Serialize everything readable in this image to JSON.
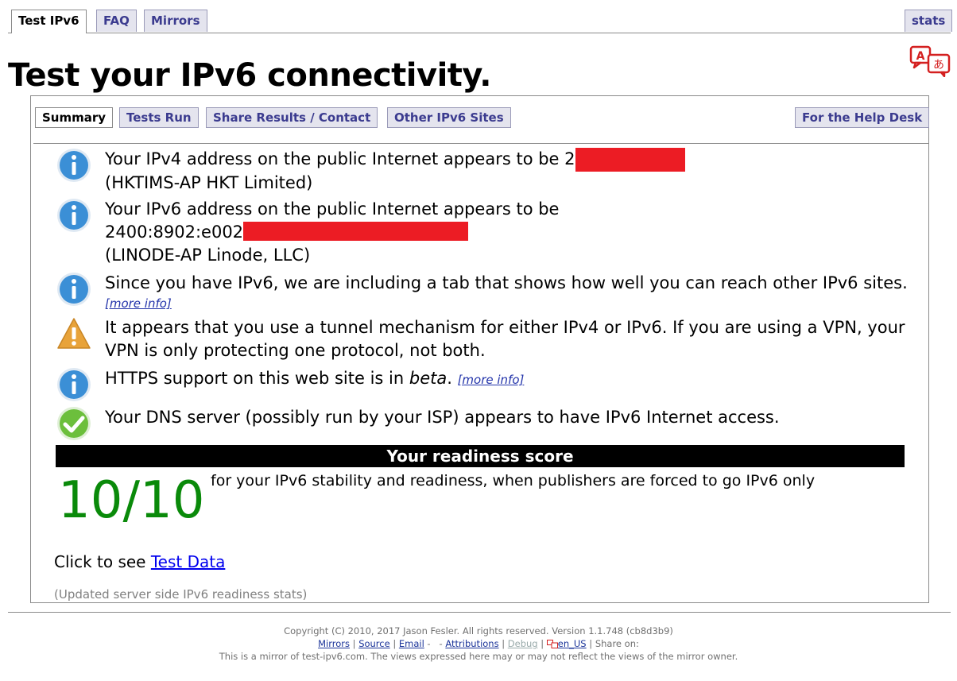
{
  "top_tabs": [
    {
      "label": "Test IPv6",
      "active": true
    },
    {
      "label": "FAQ",
      "active": false
    },
    {
      "label": "Mirrors",
      "active": false
    }
  ],
  "stats_tab": "stats",
  "page_title": "Test your IPv6 connectivity.",
  "sub_tabs": [
    {
      "label": "Summary",
      "active": true
    },
    {
      "label": "Tests Run",
      "active": false
    },
    {
      "label": "Share Results / Contact",
      "active": false
    },
    {
      "label": "Other IPv6 Sites",
      "active": false
    }
  ],
  "help_desk_tab": "For the Help Desk",
  "messages": {
    "ipv4": {
      "icon": "info-icon",
      "line1": "Your IPv4 address on the public Internet appears to be 2",
      "line2": "(HKTIMS-AP HKT Limited)"
    },
    "ipv6": {
      "icon": "info-icon",
      "line1": "Your IPv6 address on the public Internet appears to be",
      "line2": "2400:8902:e002",
      "line3": "(LINODE-AP Linode, LLC)"
    },
    "tab_note": {
      "icon": "info-icon",
      "line1": "Since you have IPv6, we are including a tab that shows how well you can reach other IPv6 sites.",
      "more": "[more info]"
    },
    "tunnel": {
      "icon": "warning-icon",
      "line1": "It appears that you use a tunnel mechanism for either IPv4 or IPv6. If you are using a VPN, your",
      "line2": "VPN is only protecting one protocol, not both."
    },
    "https": {
      "icon": "info-icon",
      "before": "HTTPS support on this web site is in ",
      "em": "beta",
      "after": ". ",
      "more": "[more info]"
    },
    "dns": {
      "icon": "check-icon",
      "line1": "Your DNS server (possibly run by your ISP) appears to have IPv6 Internet access."
    }
  },
  "readiness": {
    "header": "Your readiness score",
    "score": "10/10",
    "description": "for your IPv6 stability and readiness, when publishers are forced to go IPv6 only"
  },
  "click_prefix": "Click to see ",
  "test_data_link": "Test Data",
  "updated_text": "(Updated server side IPv6 readiness stats)",
  "footer": {
    "copyright": "Copyright (C) 2010, 2017 Jason Fesler. All rights reserved. Version 1.1.748 (cb8d3b9)",
    "links": {
      "mirrors": "Mirrors",
      "source": "Source",
      "email": "Email",
      "attributions": "Attributions",
      "debug": "Debug",
      "locale": "en_US"
    },
    "share_on": "Share on:",
    "mirror_note": "This is a mirror of test-ipv6.com. The views expressed here may or may not reflect the views of the mirror owner."
  },
  "colors": {
    "tab_bg": "#e4e4ee",
    "tab_text": "#3b3b8f",
    "score_green": "#0a8a0a",
    "redaction": "#ec1c24",
    "info_blue": "#3b8fd6",
    "warn_orange": "#e8a33a",
    "check_green": "#6cbf3c"
  }
}
